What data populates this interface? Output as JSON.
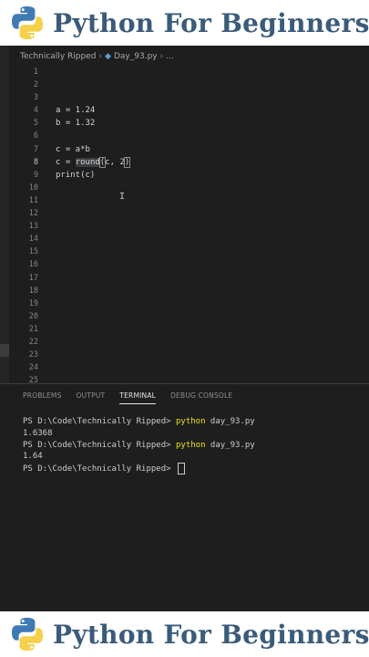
{
  "banner": {
    "title": "Python For Beginners",
    "icon": "python-logo",
    "colors": {
      "text": "#3b5b7a",
      "logo_blue": "#3f7ab5",
      "logo_yellow": "#f5d04a"
    }
  },
  "breadcrumb": {
    "folder": "Technically Ripped",
    "file": "Day_93.py",
    "more": "..."
  },
  "editor": {
    "line_numbers": [
      "1",
      "2",
      "3",
      "4",
      "5",
      "6",
      "7",
      "8",
      "9",
      "10",
      "11",
      "12",
      "13",
      "14",
      "15",
      "16",
      "17",
      "18",
      "19",
      "20",
      "21",
      "22",
      "23",
      "24",
      "25"
    ],
    "lines": {
      "l4": "a = 1.24",
      "l5": "b = 1.32",
      "l7": "c = a*b",
      "l8_prefix": "c = ",
      "l8_fn": "round",
      "l8_open": "(",
      "l8_args": "c, 2",
      "l8_close": ")",
      "l9": "print(c)"
    }
  },
  "panel": {
    "tabs": [
      "PROBLEMS",
      "OUTPUT",
      "TERMINAL",
      "DEBUG CONSOLE"
    ],
    "active_tab": "TERMINAL",
    "terminal": {
      "prompt": "PS D:\\Code\\Technically Ripped> ",
      "cmd_python": "python",
      "cmd_arg": " day_93.py",
      "out1": "1.6368",
      "out2": "1.64"
    }
  }
}
